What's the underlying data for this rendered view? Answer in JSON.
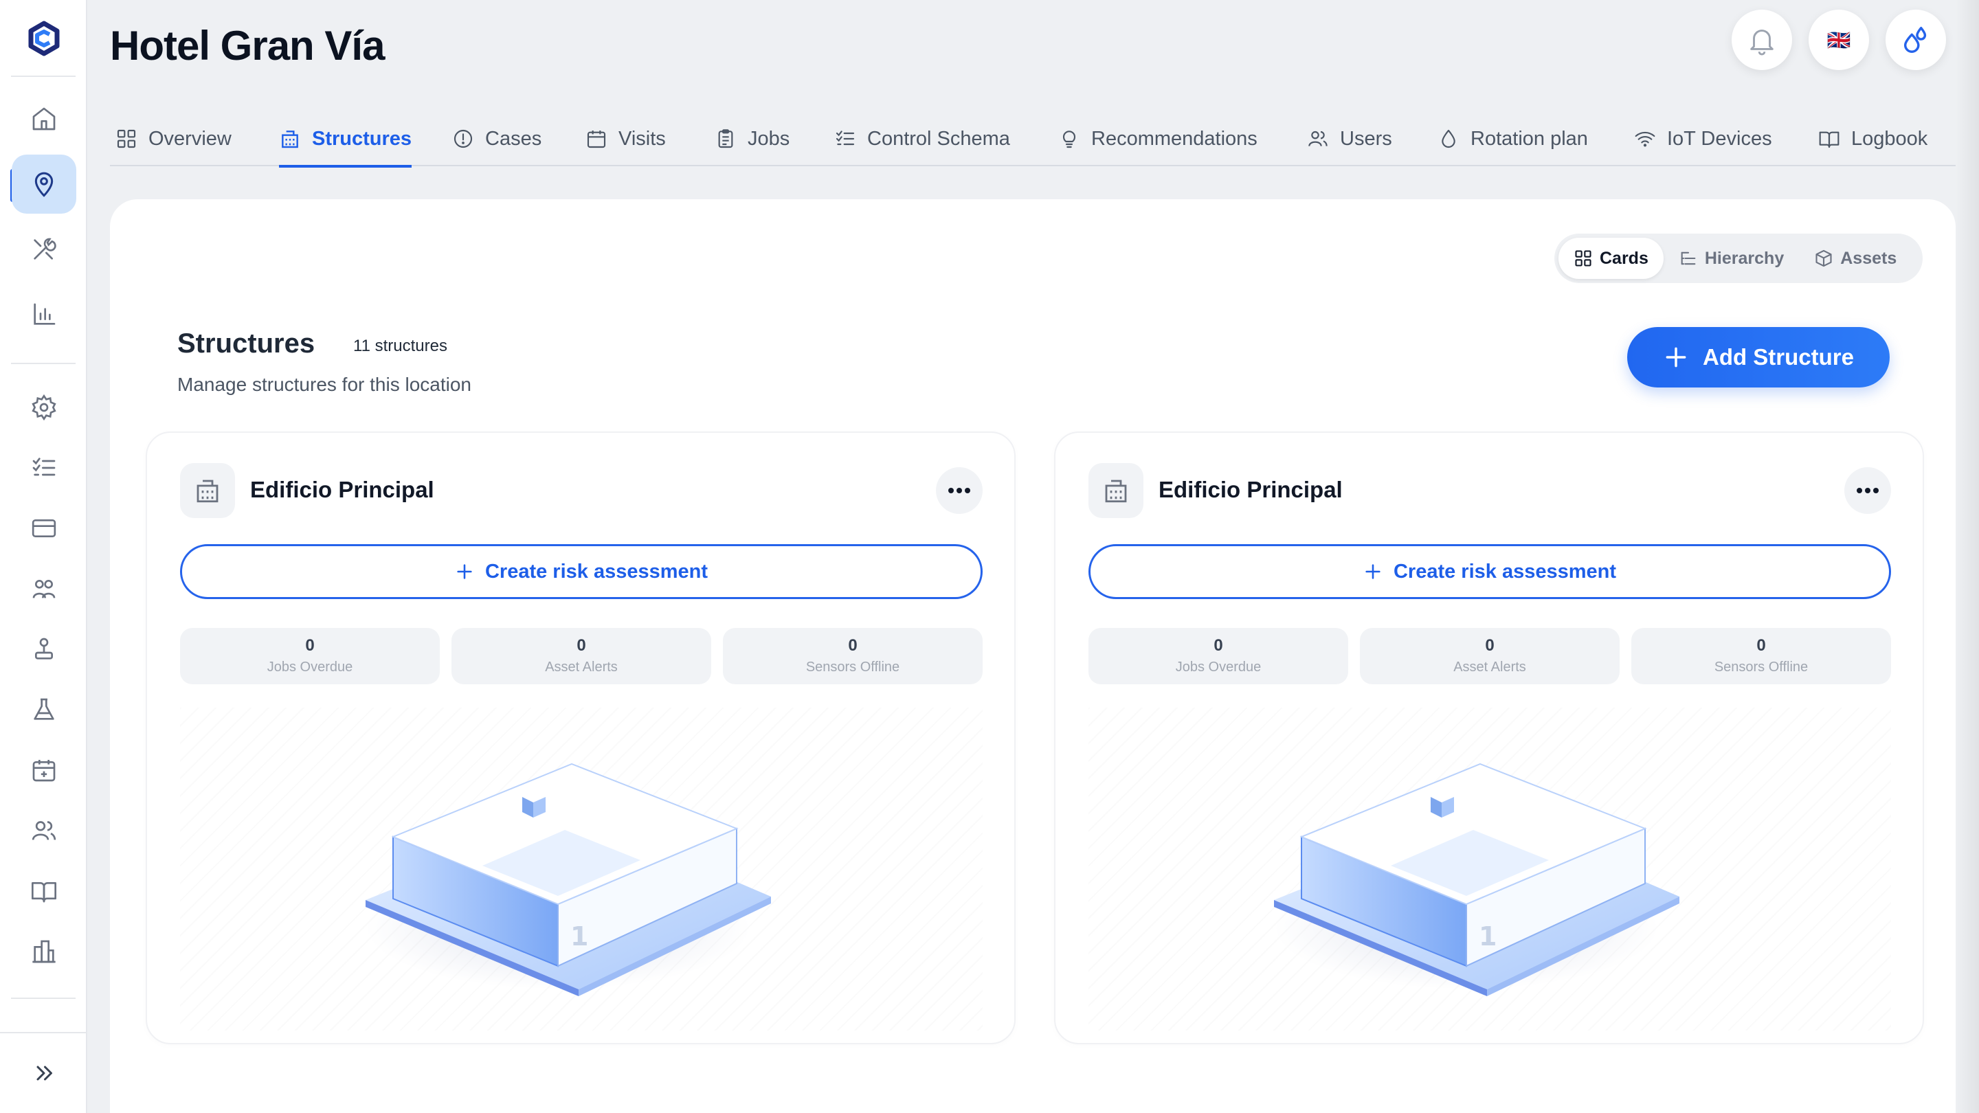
{
  "header": {
    "title": "Hotel Gran Vía",
    "language_flag": "🇬🇧"
  },
  "tabs": [
    {
      "label": "Overview",
      "icon": "grid-icon"
    },
    {
      "label": "Structures",
      "icon": "building-icon",
      "active": true
    },
    {
      "label": "Cases",
      "icon": "alert-circle-icon"
    },
    {
      "label": "Visits",
      "icon": "calendar-icon"
    },
    {
      "label": "Jobs",
      "icon": "clipboard-icon"
    },
    {
      "label": "Control Schema",
      "icon": "checklist-icon"
    },
    {
      "label": "Recommendations",
      "icon": "lightbulb-icon"
    },
    {
      "label": "Users",
      "icon": "users-icon"
    },
    {
      "label": "Rotation plan",
      "icon": "droplet-icon"
    },
    {
      "label": "IoT Devices",
      "icon": "wifi-icon"
    },
    {
      "label": "Logbook",
      "icon": "book-icon"
    }
  ],
  "view_toggle": {
    "cards": "Cards",
    "hierarchy": "Hierarchy",
    "assets": "Assets",
    "active": "cards"
  },
  "section": {
    "title": "Structures",
    "count": "11 structures",
    "subtitle": "Manage structures for this location",
    "add_button": "Add Structure"
  },
  "cards": [
    {
      "title": "Edificio Principal",
      "risk_button": "Create risk assessment",
      "stats": [
        {
          "value": "0",
          "label": "Jobs Overdue"
        },
        {
          "value": "0",
          "label": "Asset Alerts"
        },
        {
          "value": "0",
          "label": "Sensors Offline"
        }
      ],
      "floor_label": "1"
    },
    {
      "title": "Edificio Principal",
      "risk_button": "Create risk assessment",
      "stats": [
        {
          "value": "0",
          "label": "Jobs Overdue"
        },
        {
          "value": "0",
          "label": "Asset Alerts"
        },
        {
          "value": "0",
          "label": "Sensors Offline"
        }
      ],
      "floor_label": "1"
    }
  ],
  "colors": {
    "accent": "#1d5ee8",
    "active_nav_bg": "#cfe3fb",
    "page_bg": "#eef0f3"
  }
}
